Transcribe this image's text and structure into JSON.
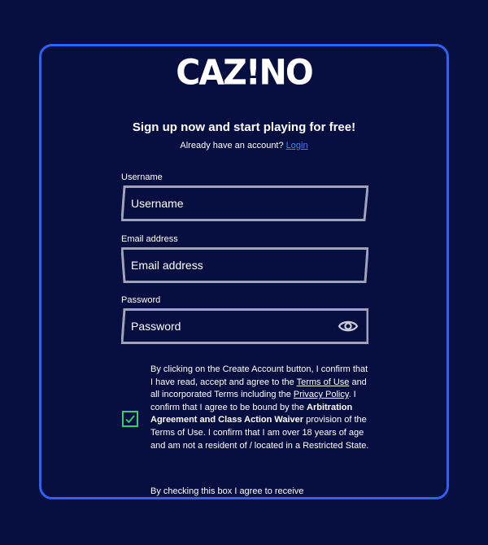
{
  "brand": {
    "logo_text": "CAZ!NO"
  },
  "header": {
    "headline": "Sign up now and start playing for free!",
    "already_text": "Already have an account?",
    "login_link": "Login"
  },
  "form": {
    "username": {
      "label": "Username",
      "placeholder": "Username",
      "value": ""
    },
    "email": {
      "label": "Email address",
      "placeholder": "Email address",
      "value": ""
    },
    "password": {
      "label": "Password",
      "placeholder": "Password",
      "value": ""
    },
    "password_visibility_icon": "eye-icon"
  },
  "consent": {
    "checked": true,
    "text_1": "By clicking on the Create Account button, I confirm that I have read, accept and agree to the ",
    "terms_link": "Terms of Use",
    "text_2": " and all incorporated Terms including the ",
    "privacy_link": "Privacy Policy",
    "text_3": ". I confirm that I agree to be bound by the ",
    "bold_text": "Arbitration Agreement and Class Action Waiver",
    "text_4": " provision of the Terms of Use. I confirm that I am over 18 years of age and am not a resident of / located in a Restricted State."
  },
  "marketing": {
    "text": "By checking this box I agree to receive"
  },
  "colors": {
    "background": "#070e40",
    "modal_border": "#2d63f0",
    "link": "#4c7dff",
    "checkbox": "#2dd36f",
    "input_border": "#9ea3b8"
  }
}
